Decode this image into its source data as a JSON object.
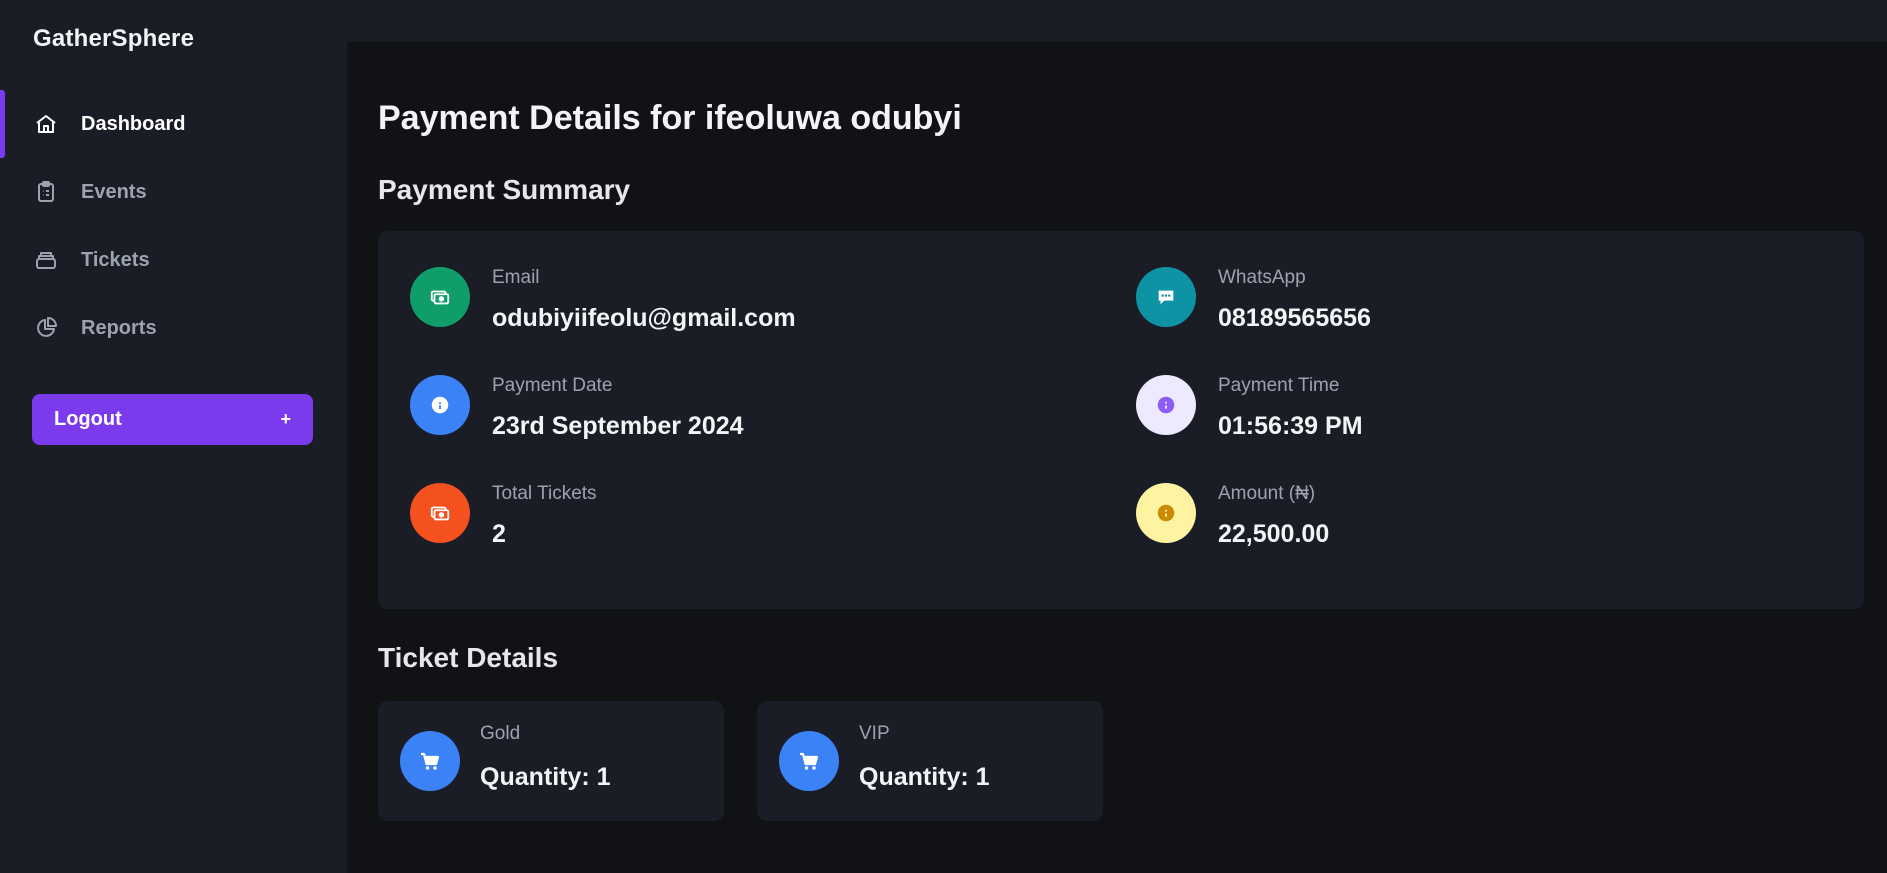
{
  "app": {
    "brand": "GatherSphere"
  },
  "sidebar": {
    "items": [
      {
        "label": "Dashboard",
        "icon": "home-icon",
        "active": true
      },
      {
        "label": "Events",
        "icon": "clipboard-icon",
        "active": false
      },
      {
        "label": "Tickets",
        "icon": "ticket-stack-icon",
        "active": false
      },
      {
        "label": "Reports",
        "icon": "pie-chart-icon",
        "active": false
      }
    ],
    "logout": {
      "label": "Logout",
      "icon": "+"
    }
  },
  "main": {
    "title": "Payment Details for ifeoluwa odubyi",
    "summary": {
      "heading": "Payment Summary",
      "fields": [
        {
          "label": "Email",
          "value": "odubiyiifeolu@gmail.com",
          "icon": "money-icon",
          "color": "#0f9d6a"
        },
        {
          "label": "WhatsApp",
          "value": "08189565656",
          "icon": "chat-icon",
          "color": "#0e93a4"
        },
        {
          "label": "Payment Date",
          "value": "23rd September 2024",
          "icon": "info-icon",
          "color": "#3b82f6"
        },
        {
          "label": "Payment Time",
          "value": "01:56:39 PM",
          "icon": "info-icon",
          "color": "#ede9fe"
        },
        {
          "label": "Total Tickets",
          "value": "2",
          "icon": "money-icon",
          "color": "#f4511e"
        },
        {
          "label": "Amount (₦)",
          "value": "22,500.00",
          "icon": "info-icon",
          "color": "#fef3a0"
        }
      ]
    },
    "tickets": {
      "heading": "Ticket Details",
      "items": [
        {
          "name": "Gold",
          "quantity": "Quantity: 1",
          "icon": "cart-icon"
        },
        {
          "name": "VIP",
          "quantity": "Quantity: 1",
          "icon": "cart-icon"
        }
      ]
    }
  },
  "colors": {
    "accent": "#7c3aed",
    "sidebar_bg": "#1b1d26",
    "main_bg": "#111216",
    "card_bg": "#1b1d26",
    "ticket_icon": "#3b82f6"
  }
}
